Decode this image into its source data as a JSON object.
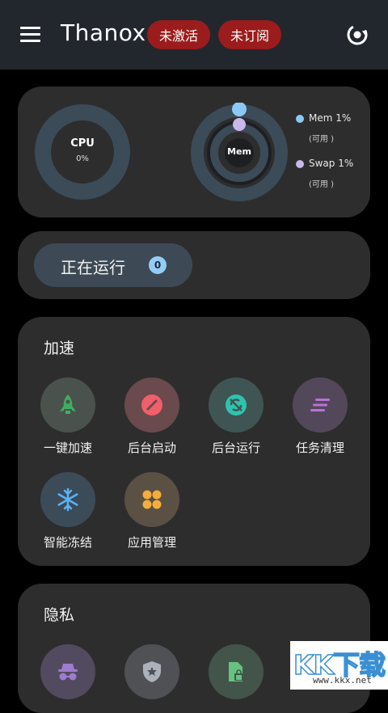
{
  "header": {
    "title": "Thanox",
    "badges": [
      "未激活",
      "未订阅"
    ]
  },
  "stats": {
    "cpu": {
      "label": "CPU",
      "value": "0%"
    },
    "mem": {
      "label": "Mem"
    },
    "legend": [
      {
        "name": "Mem 1%",
        "sub": "(可用 )",
        "color": "#8cc8f5"
      },
      {
        "name": "Swap 1%",
        "sub": "(可用 )",
        "color": "#c9b8ec"
      }
    ]
  },
  "running": {
    "label": "正在运行",
    "count": "0"
  },
  "speed_section": {
    "title": "加速",
    "items": [
      {
        "label": "一键加速",
        "icon": "rocket-icon",
        "bg": "#4a524d",
        "color": "#3fae63"
      },
      {
        "label": "后台启动",
        "icon": "block-icon",
        "bg": "#6a4a4c",
        "color": "#ef5f6c"
      },
      {
        "label": "后台运行",
        "icon": "sync-icon",
        "bg": "#3f5554",
        "color": "#2fc3ad"
      },
      {
        "label": "任务清理",
        "icon": "clear-all-icon",
        "bg": "#52485a",
        "color": "#b872d6"
      },
      {
        "label": "智能冻结",
        "icon": "snowflake-icon",
        "bg": "#3c4b58",
        "color": "#5bb2f5"
      },
      {
        "label": "应用管理",
        "icon": "apps-grid-icon",
        "bg": "#5a5043",
        "color": "#f4ad3d"
      }
    ]
  },
  "privacy_section": {
    "title": "隐私",
    "items": [
      {
        "icon": "incognito-icon",
        "bg": "#524a5e",
        "color": "#9d7ccf"
      },
      {
        "icon": "shield-star-icon",
        "bg": "#4f5154",
        "color": "#aab2bc"
      },
      {
        "icon": "file-lock-icon",
        "bg": "#43544a",
        "color": "#67c27f"
      }
    ]
  },
  "watermark": {
    "text": "KK下载",
    "url": "www.kkx.net"
  }
}
